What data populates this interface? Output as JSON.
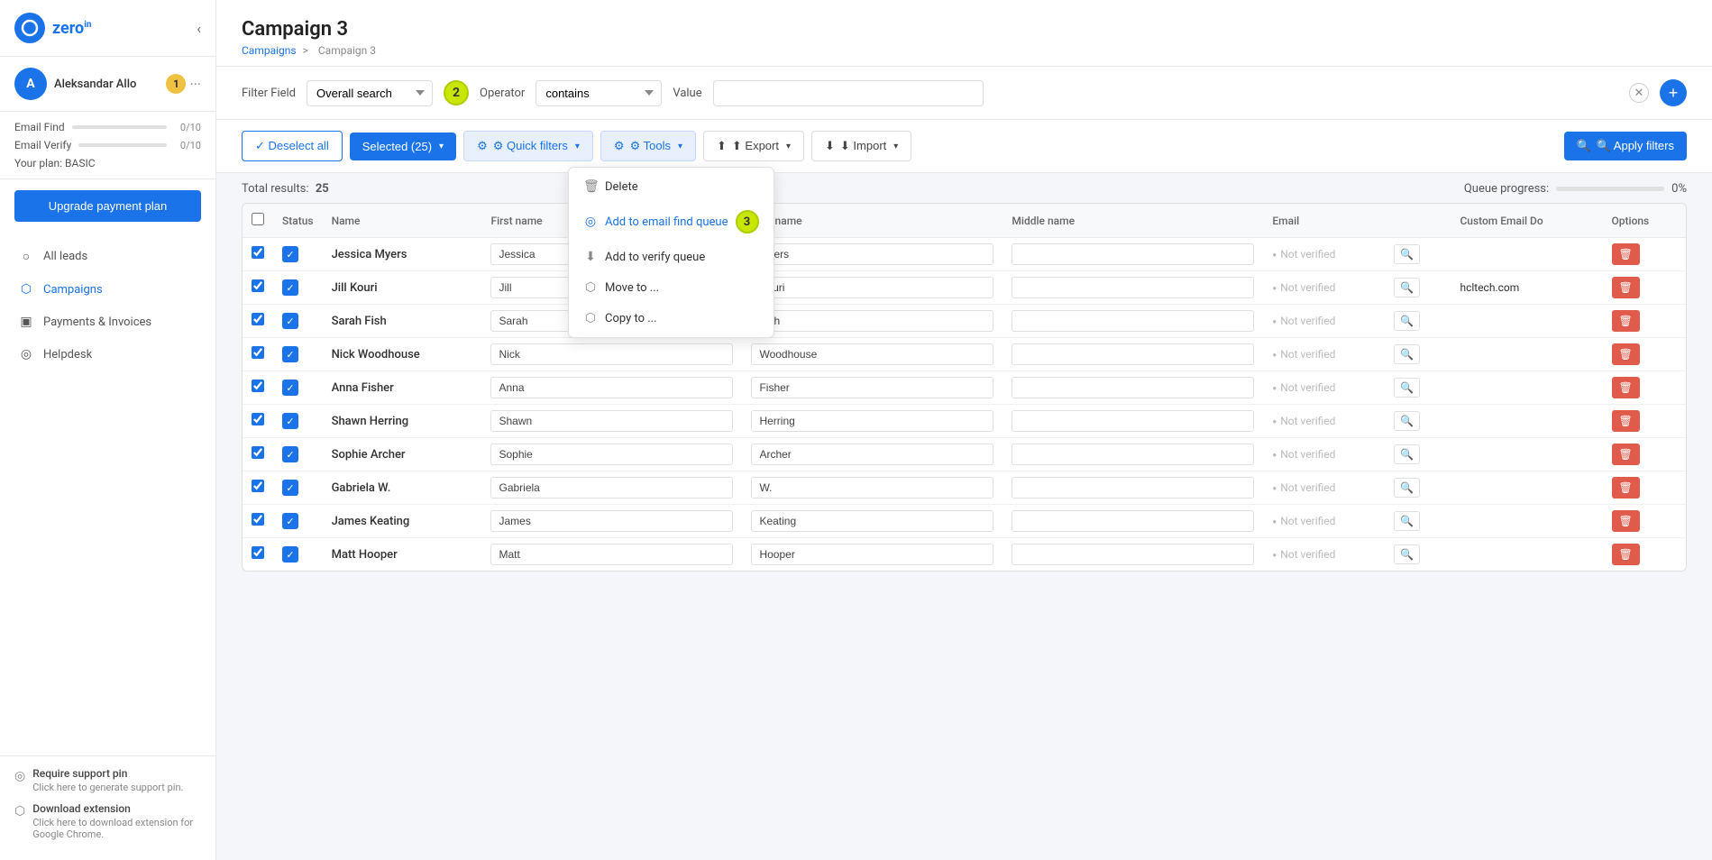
{
  "sidebar": {
    "logo": "zero",
    "logo_sup": "in",
    "user_name": "Aleksandar Allo",
    "email_find_label": "Email Find",
    "email_find_val": "0/10",
    "email_verify_label": "Email Verify",
    "email_verify_val": "0/10",
    "plan_label": "Your plan: BASIC",
    "upgrade_btn": "Upgrade payment plan",
    "nav": [
      {
        "id": "all-leads",
        "label": "All leads",
        "icon": "○"
      },
      {
        "id": "campaigns",
        "label": "Campaigns",
        "icon": "⬡"
      },
      {
        "id": "payments",
        "label": "Payments & Invoices",
        "icon": "▣"
      },
      {
        "id": "helpdesk",
        "label": "Helpdesk",
        "icon": "◎"
      }
    ],
    "support_pin_title": "Require support pin",
    "support_pin_desc": "Click here to generate support pin.",
    "download_ext_title": "Download extension",
    "download_ext_desc": "Click here to download extension for Google Chrome."
  },
  "header": {
    "title": "Campaign 3",
    "breadcrumb_home": "Campaigns",
    "breadcrumb_sep": ">",
    "breadcrumb_current": "Campaign 3"
  },
  "filter": {
    "field_label": "Filter Field",
    "field_value": "Overall search",
    "operator_label": "Operator",
    "operator_value": "contains",
    "value_label": "Value",
    "value_placeholder": ""
  },
  "toolbar": {
    "deselect_all": "✓ Deselect all",
    "selected": "Selected (25)",
    "quick_filters": "⚙ Quick filters",
    "tools": "⚙ Tools",
    "export": "⬆ Export",
    "import": "⬇ Import",
    "apply_filters": "🔍 Apply filters"
  },
  "dropdown": {
    "items": [
      {
        "id": "delete",
        "label": "Delete",
        "icon": "🗑"
      },
      {
        "id": "add-email-find",
        "label": "Add to email find queue",
        "icon": "◎",
        "highlight": true
      },
      {
        "id": "add-verify",
        "label": "Add to verify queue",
        "icon": "⬇"
      },
      {
        "id": "move-to",
        "label": "Move to ...",
        "icon": "⬡"
      },
      {
        "id": "copy-to",
        "label": "Copy to ...",
        "icon": "⬡"
      }
    ]
  },
  "results": {
    "total_label": "Total results:",
    "total_count": "25",
    "queue_label": "Queue progress:",
    "queue_pct": "0%",
    "queue_fill": 0
  },
  "table": {
    "headers": [
      "Status",
      "Name",
      "First name",
      "Last name",
      "Middle name",
      "Email",
      "",
      "Custom Email Do",
      "Options"
    ],
    "rows": [
      {
        "checked": true,
        "name": "Jessica Myers",
        "first": "Jessica",
        "last": "Myers",
        "middle": "",
        "email_status": "Not verified",
        "custom_email": ""
      },
      {
        "checked": true,
        "name": "Jill Kouri",
        "first": "Jill",
        "last": "Kouri",
        "middle": "",
        "email_status": "Not verified",
        "custom_email": "hcltech.com"
      },
      {
        "checked": true,
        "name": "Sarah Fish",
        "first": "Sarah",
        "last": "Fish",
        "middle": "",
        "email_status": "Not verified",
        "custom_email": ""
      },
      {
        "checked": true,
        "name": "Nick Woodhouse",
        "first": "Nick",
        "last": "Woodhouse",
        "middle": "",
        "email_status": "Not verified",
        "custom_email": ""
      },
      {
        "checked": true,
        "name": "Anna Fisher",
        "first": "Anna",
        "last": "Fisher",
        "middle": "",
        "email_status": "Not verified",
        "custom_email": ""
      },
      {
        "checked": true,
        "name": "Shawn Herring",
        "first": "Shawn",
        "last": "Herring",
        "middle": "",
        "email_status": "Not verified",
        "custom_email": ""
      },
      {
        "checked": true,
        "name": "Sophie Archer",
        "first": "Sophie",
        "last": "Archer",
        "middle": "",
        "email_status": "Not verified",
        "custom_email": ""
      },
      {
        "checked": true,
        "name": "Gabriela W.",
        "first": "Gabriela",
        "last": "W.",
        "middle": "",
        "email_status": "Not verified",
        "custom_email": ""
      },
      {
        "checked": true,
        "name": "James Keating",
        "first": "James",
        "last": "Keating",
        "middle": "",
        "email_status": "Not verified",
        "custom_email": ""
      },
      {
        "checked": true,
        "name": "Matt Hooper",
        "first": "Matt",
        "last": "Hooper",
        "middle": "",
        "email_status": "Not verified",
        "custom_email": ""
      }
    ]
  },
  "colors": {
    "primary": "#1a73e8",
    "accent_yellow": "#c8e600",
    "delete_red": "#e05b4b"
  }
}
